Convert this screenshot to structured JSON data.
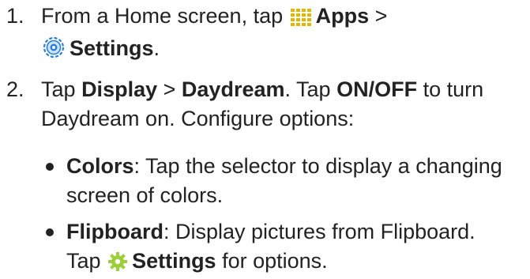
{
  "steps": [
    {
      "number": "1.",
      "line1_prefix": "From a Home screen, tap",
      "apps_label": "Apps",
      "separator": ">",
      "settings_label": "Settings",
      "period": "."
    },
    {
      "number": "2.",
      "tap_word": "Tap",
      "display_label": "Display",
      "separator": ">",
      "daydream_label": "Daydream",
      "period_tap": ". Tap",
      "onoff_label": "ON/OFF",
      "line1_suffix": "to turn",
      "line2": "Daydream on. Configure options:"
    }
  ],
  "bullets": [
    {
      "title": "Colors",
      "line1_rest": ": Tap the selector to display a changing",
      "line2": "screen of colors."
    },
    {
      "title": "Flipboard",
      "line1_rest": ": Display pictures from Flipboard.",
      "line2_prefix": "Tap",
      "settings_label": "Settings",
      "line2_suffix": "for options."
    }
  ],
  "icons": {
    "apps": "apps-grid-icon",
    "settings": "settings-gear-icon",
    "flipboard_settings": "gear-icon"
  },
  "colors": {
    "text": "#222222",
    "apps_icon": "#e0b800",
    "settings_icon_blue": "#2a7fd4",
    "gear_icon": "#9ccf3a"
  }
}
